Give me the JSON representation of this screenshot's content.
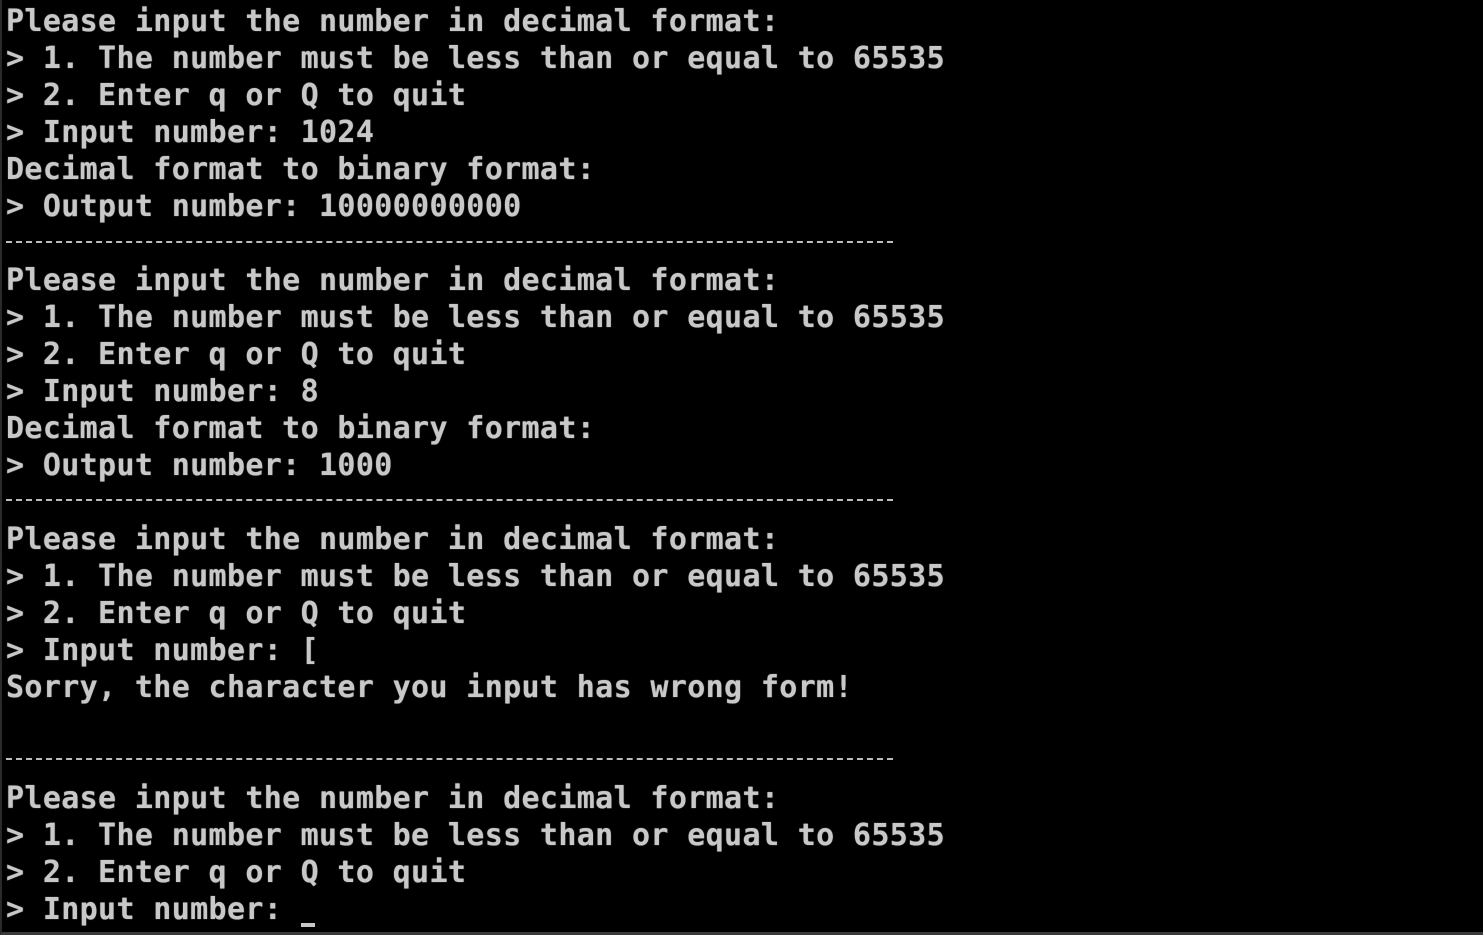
{
  "colors": {
    "background": "#000000",
    "foreground": "#c8c8c8"
  },
  "terminal": {
    "blocks": [
      {
        "prompt": "Please input the number in decimal format:",
        "rule1": "> 1. The number must be less than or equal to 65535",
        "rule2": "> 2. Enter q or Q to quit",
        "input_label": "> Input number: ",
        "input_value": "1024",
        "result_header": "Decimal format to binary format:",
        "output_label": "> Output number: ",
        "output_value": "10000000000"
      },
      {
        "prompt": "Please input the number in decimal format:",
        "rule1": "> 1. The number must be less than or equal to 65535",
        "rule2": "> 2. Enter q or Q to quit",
        "input_label": "> Input number: ",
        "input_value": "8",
        "result_header": "Decimal format to binary format:",
        "output_label": "> Output number: ",
        "output_value": "1000"
      },
      {
        "prompt": "Please input the number in decimal format:",
        "rule1": "> 1. The number must be less than or equal to 65535",
        "rule2": "> 2. Enter q or Q to quit",
        "input_label": "> Input number: ",
        "input_value": "[",
        "error": "Sorry, the character you input has wrong form!"
      },
      {
        "prompt": "Please input the number in decimal format:",
        "rule1": "> 1. The number must be less than or equal to 65535",
        "rule2": "> 2. Enter q or Q to quit",
        "input_label": "> Input number: ",
        "input_value": ""
      }
    ]
  }
}
